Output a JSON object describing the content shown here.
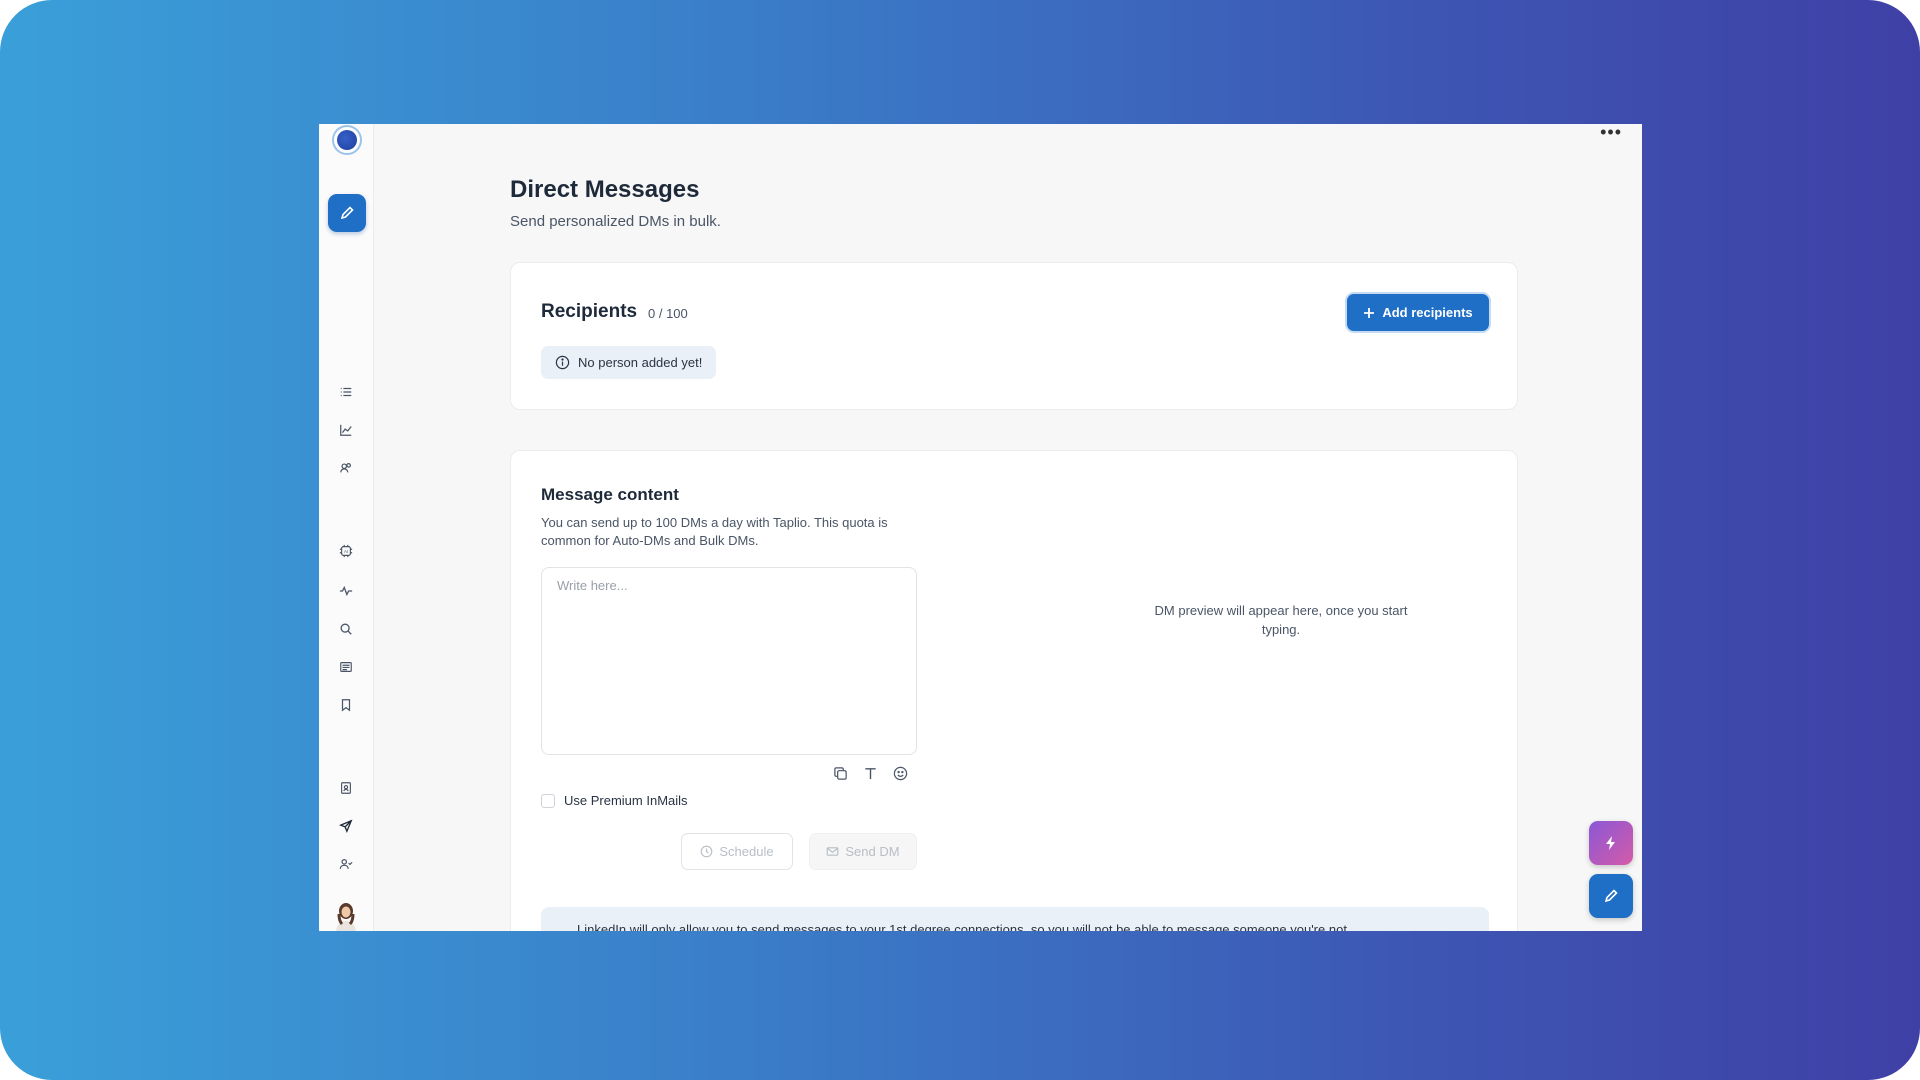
{
  "page": {
    "title": "Direct Messages",
    "subtitle": "Send personalized DMs in bulk."
  },
  "recipients": {
    "title": "Recipients",
    "count": "0 / 100",
    "add_label": "Add recipients",
    "empty_text": "No person added yet!"
  },
  "message": {
    "title": "Message content",
    "description": "You can send up to 100 DMs a day with Taplio. This quota is common for Auto-DMs and Bulk DMs.",
    "placeholder": "Write here...",
    "premium_label": "Use Premium InMails",
    "schedule_label": "Schedule",
    "send_label": "Send DM",
    "preview_text": "DM preview will appear here, once you start typing.",
    "notice_text": "LinkedIn will only allow you to send messages to your 1st degree connections, so you will not be able to message someone you're not"
  },
  "top": {
    "more_label": "•••"
  },
  "colors": {
    "accent": "#1f6fc7",
    "fab_gradient_start": "#8a58d6",
    "fab_gradient_end": "#d55aa8"
  },
  "icons": {
    "sidebar": [
      "list-icon",
      "chart-icon",
      "users-icon",
      "ai-icon",
      "activity-icon",
      "search-icon",
      "newspaper-icon",
      "bookmark-icon",
      "contact-icon",
      "send-icon",
      "people-icon",
      "settings-icon",
      "help-icon"
    ]
  }
}
